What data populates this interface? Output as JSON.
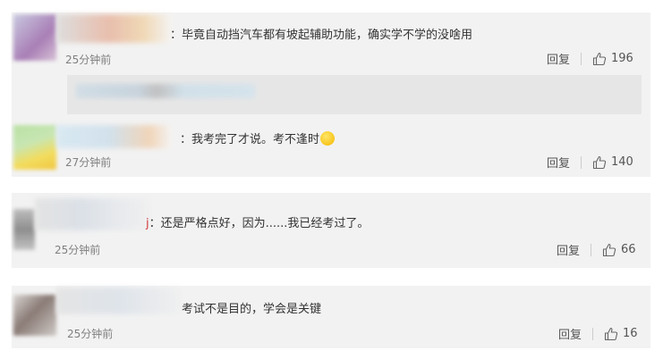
{
  "comments": [
    {
      "text": "：毕竟自动挡汽车都有坡起辅助功能，确实学不学的没啥用",
      "time": "25分钟前",
      "reply_label": "回复",
      "likes": "196"
    },
    {
      "text": "：我考完了才说。考不逢时",
      "time": "27分钟前",
      "reply_label": "回复",
      "likes": "140"
    },
    {
      "text": "：还是严格点好，因为......我已经考过了。",
      "time": "25分钟前",
      "reply_label": "回复",
      "likes": "66"
    },
    {
      "text": "考试不是目的，学会是关键",
      "time": "25分钟前",
      "reply_label": "回复",
      "likes": "16"
    }
  ],
  "icons": {
    "like": "thumbs-up-icon",
    "emoji": "crying-laughing-emoji-icon"
  },
  "colors": {
    "card_bg": "#f2f2f2",
    "text": "#333333",
    "meta": "#808080"
  }
}
